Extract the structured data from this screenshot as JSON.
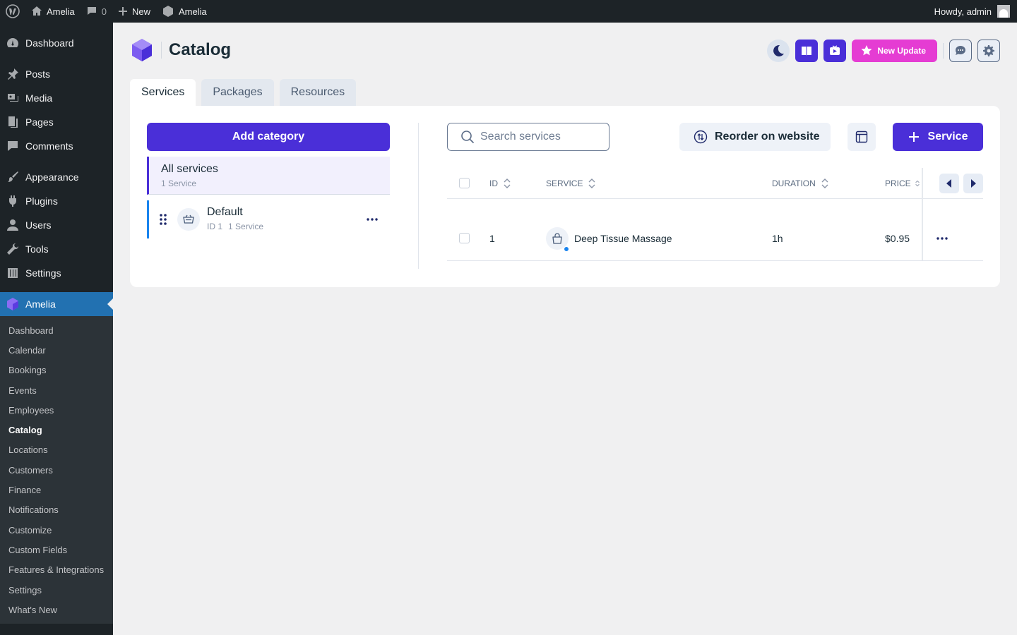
{
  "adminbar": {
    "site_name": "Amelia",
    "comments_count": "0",
    "new_label": "New",
    "plugin_name": "Amelia",
    "greeting": "Howdy, admin"
  },
  "sidebar": {
    "items": [
      {
        "label": "Dashboard",
        "icon": "dashboard-icon"
      },
      {
        "label": "Posts",
        "icon": "pin-icon"
      },
      {
        "label": "Media",
        "icon": "media-icon"
      },
      {
        "label": "Pages",
        "icon": "pages-icon"
      },
      {
        "label": "Comments",
        "icon": "comment-icon"
      },
      {
        "label": "Appearance",
        "icon": "brush-icon"
      },
      {
        "label": "Plugins",
        "icon": "plugin-icon"
      },
      {
        "label": "Users",
        "icon": "user-icon"
      },
      {
        "label": "Tools",
        "icon": "wrench-icon"
      },
      {
        "label": "Settings",
        "icon": "sliders-icon"
      },
      {
        "label": "Amelia",
        "icon": "amelia-icon"
      }
    ],
    "submenu": [
      "Dashboard",
      "Calendar",
      "Bookings",
      "Events",
      "Employees",
      "Catalog",
      "Locations",
      "Customers",
      "Finance",
      "Notifications",
      "Customize",
      "Custom Fields",
      "Features & Integrations",
      "Settings",
      "What's New"
    ],
    "current_submenu": "Catalog"
  },
  "header": {
    "title": "Catalog",
    "new_update_label": "New Update"
  },
  "tabs": [
    "Services",
    "Packages",
    "Resources"
  ],
  "categories": {
    "add_label": "Add category",
    "all": {
      "title": "All services",
      "count": "1 Service"
    },
    "default": {
      "title": "Default",
      "id": "ID 1",
      "count": "1 Service"
    }
  },
  "toolbar": {
    "search_placeholder": "Search services",
    "reorder_label": "Reorder on website",
    "add_service_label": "Service"
  },
  "table": {
    "columns": [
      "ID",
      "SERVICE",
      "DURATION",
      "PRICE"
    ],
    "rows": [
      {
        "id": "1",
        "service": "Deep Tissue Massage",
        "duration": "1h",
        "price": "$0.95"
      }
    ]
  },
  "colors": {
    "primary": "#4a2fd8",
    "accent": "#e53cd3",
    "wp_admin_dark": "#1d2327",
    "wp_active": "#2271b1"
  }
}
